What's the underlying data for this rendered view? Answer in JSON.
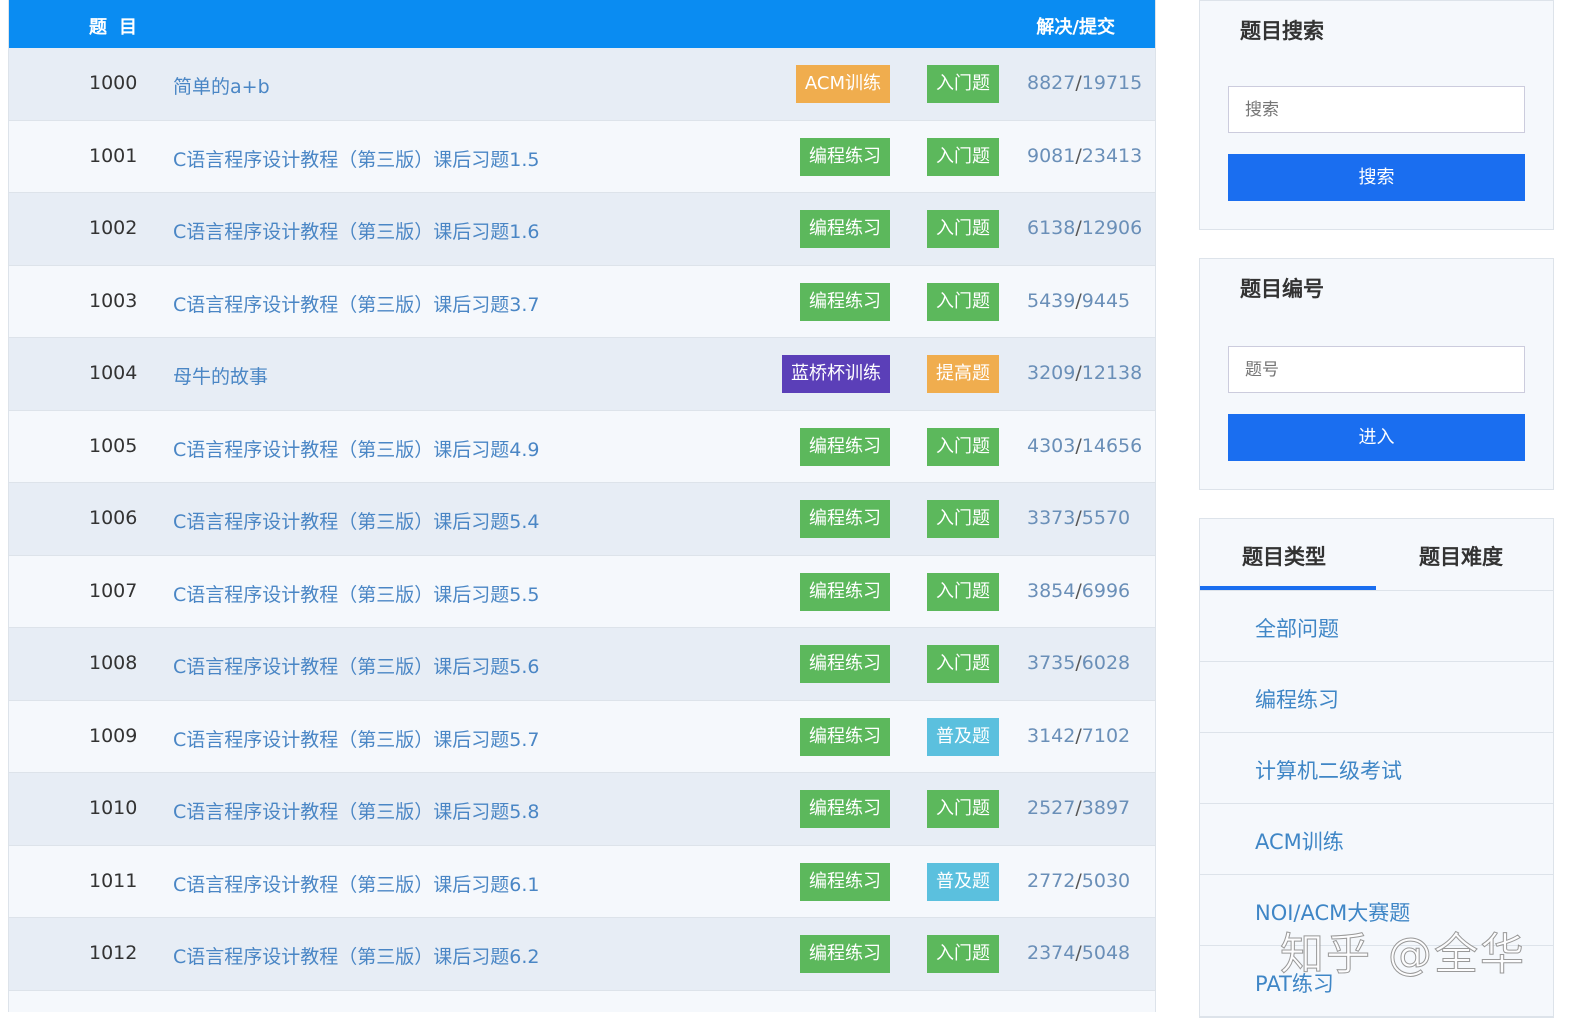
{
  "table": {
    "header_title": "题目",
    "header_stat": "解决/提交",
    "rows": [
      {
        "id": "1000",
        "title": "简单的a+b",
        "type": "ACM训练",
        "type_color": "#f0ad4e",
        "level": "入门题",
        "level_color": "#5cb85c",
        "solved": "8827",
        "submitted": "19715"
      },
      {
        "id": "1001",
        "title": "C语言程序设计教程（第三版）课后习题1.5",
        "type": "编程练习",
        "type_color": "#5cb85c",
        "level": "入门题",
        "level_color": "#5cb85c",
        "solved": "9081",
        "submitted": "23413"
      },
      {
        "id": "1002",
        "title": "C语言程序设计教程（第三版）课后习题1.6",
        "type": "编程练习",
        "type_color": "#5cb85c",
        "level": "入门题",
        "level_color": "#5cb85c",
        "solved": "6138",
        "submitted": "12906"
      },
      {
        "id": "1003",
        "title": "C语言程序设计教程（第三版）课后习题3.7",
        "type": "编程练习",
        "type_color": "#5cb85c",
        "level": "入门题",
        "level_color": "#5cb85c",
        "solved": "5439",
        "submitted": "9445"
      },
      {
        "id": "1004",
        "title": "母牛的故事",
        "type": "蓝桥杯训练",
        "type_color": "#5b3fb8",
        "level": "提高题",
        "level_color": "#f0ad4e",
        "solved": "3209",
        "submitted": "12138"
      },
      {
        "id": "1005",
        "title": "C语言程序设计教程（第三版）课后习题4.9",
        "type": "编程练习",
        "type_color": "#5cb85c",
        "level": "入门题",
        "level_color": "#5cb85c",
        "solved": "4303",
        "submitted": "14656"
      },
      {
        "id": "1006",
        "title": "C语言程序设计教程（第三版）课后习题5.4",
        "type": "编程练习",
        "type_color": "#5cb85c",
        "level": "入门题",
        "level_color": "#5cb85c",
        "solved": "3373",
        "submitted": "5570"
      },
      {
        "id": "1007",
        "title": "C语言程序设计教程（第三版）课后习题5.5",
        "type": "编程练习",
        "type_color": "#5cb85c",
        "level": "入门题",
        "level_color": "#5cb85c",
        "solved": "3854",
        "submitted": "6996"
      },
      {
        "id": "1008",
        "title": "C语言程序设计教程（第三版）课后习题5.6",
        "type": "编程练习",
        "type_color": "#5cb85c",
        "level": "入门题",
        "level_color": "#5cb85c",
        "solved": "3735",
        "submitted": "6028"
      },
      {
        "id": "1009",
        "title": "C语言程序设计教程（第三版）课后习题5.7",
        "type": "编程练习",
        "type_color": "#5cb85c",
        "level": "普及题",
        "level_color": "#5bc0de",
        "solved": "3142",
        "submitted": "7102"
      },
      {
        "id": "1010",
        "title": "C语言程序设计教程（第三版）课后习题5.8",
        "type": "编程练习",
        "type_color": "#5cb85c",
        "level": "入门题",
        "level_color": "#5cb85c",
        "solved": "2527",
        "submitted": "3897"
      },
      {
        "id": "1011",
        "title": "C语言程序设计教程（第三版）课后习题6.1",
        "type": "编程练习",
        "type_color": "#5cb85c",
        "level": "普及题",
        "level_color": "#5bc0de",
        "solved": "2772",
        "submitted": "5030"
      },
      {
        "id": "1012",
        "title": "C语言程序设计教程（第三版）课后习题6.2",
        "type": "编程练习",
        "type_color": "#5cb85c",
        "level": "入门题",
        "level_color": "#5cb85c",
        "solved": "2374",
        "submitted": "5048"
      }
    ]
  },
  "search_panel": {
    "title": "题目搜索",
    "placeholder": "搜索",
    "button": "搜索"
  },
  "id_panel": {
    "title": "题目编号",
    "placeholder": "题号",
    "button": "进入"
  },
  "category_panel": {
    "tabs": [
      "题目类型",
      "题目难度"
    ],
    "active_tab": 0,
    "items": [
      "全部问题",
      "编程练习",
      "计算机二级考试",
      "ACM训练",
      "NOI/ACM大赛题",
      "PAT练习"
    ]
  },
  "watermark": "知乎 @全华"
}
